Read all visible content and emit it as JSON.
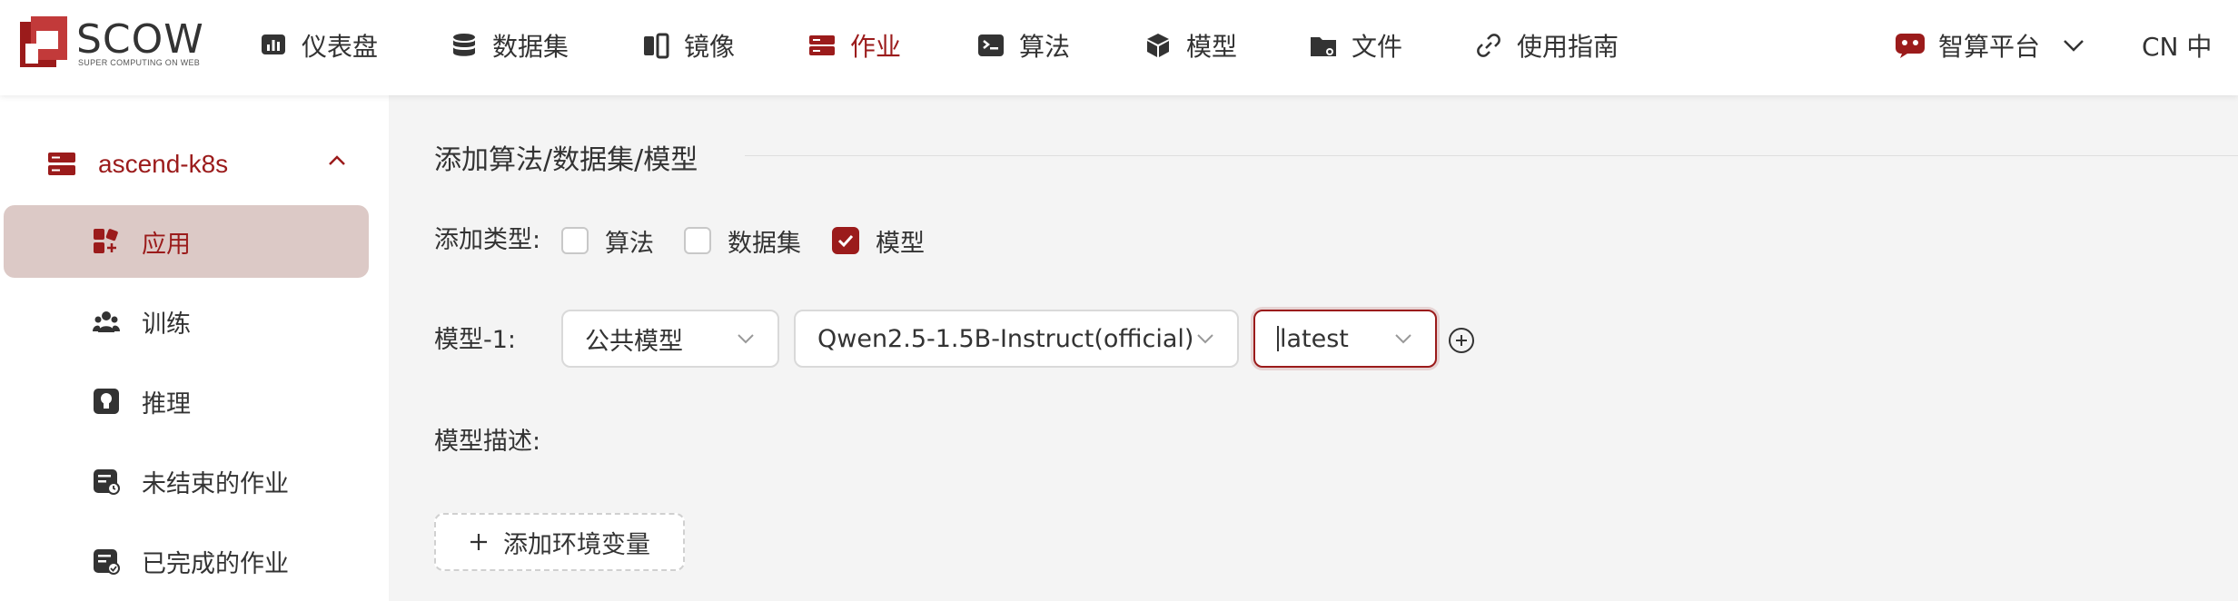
{
  "brand": {
    "name": "SCOW",
    "tagline": "SUPER COMPUTING ON WEB",
    "accent": "#9b1b1b"
  },
  "nav": [
    {
      "label": "仪表盘",
      "icon": "dashboard-icon"
    },
    {
      "label": "数据集",
      "icon": "database-icon"
    },
    {
      "label": "镜像",
      "icon": "image-icon"
    },
    {
      "label": "作业",
      "icon": "job-icon",
      "active": true
    },
    {
      "label": "算法",
      "icon": "terminal-icon"
    },
    {
      "label": "模型",
      "icon": "cube-icon"
    },
    {
      "label": "文件",
      "icon": "folder-icon"
    },
    {
      "label": "使用指南",
      "icon": "link-icon"
    }
  ],
  "header_right": {
    "platform_label": "智算平台",
    "lang_label": "CN 中"
  },
  "sidebar": {
    "cluster_name": "ascend-k8s",
    "items": [
      {
        "label": "应用",
        "icon": "apps-icon",
        "selected": true
      },
      {
        "label": "训练",
        "icon": "team-icon"
      },
      {
        "label": "推理",
        "icon": "bulb-icon"
      },
      {
        "label": "未结束的作业",
        "icon": "running-job-icon"
      },
      {
        "label": "已完成的作业",
        "icon": "finished-job-icon"
      }
    ]
  },
  "form": {
    "section_title": "添加算法/数据集/模型",
    "add_type_label": "添加类型:",
    "type_options": [
      {
        "label": "算法",
        "checked": false
      },
      {
        "label": "数据集",
        "checked": false
      },
      {
        "label": "模型",
        "checked": true
      }
    ],
    "model_row_label": "模型-1:",
    "model_source": "公共模型",
    "model_name": "Qwen2.5-1.5B-Instruct(official)",
    "model_version": "latest",
    "model_desc_label": "模型描述:",
    "add_env_label": "添加环境变量"
  }
}
